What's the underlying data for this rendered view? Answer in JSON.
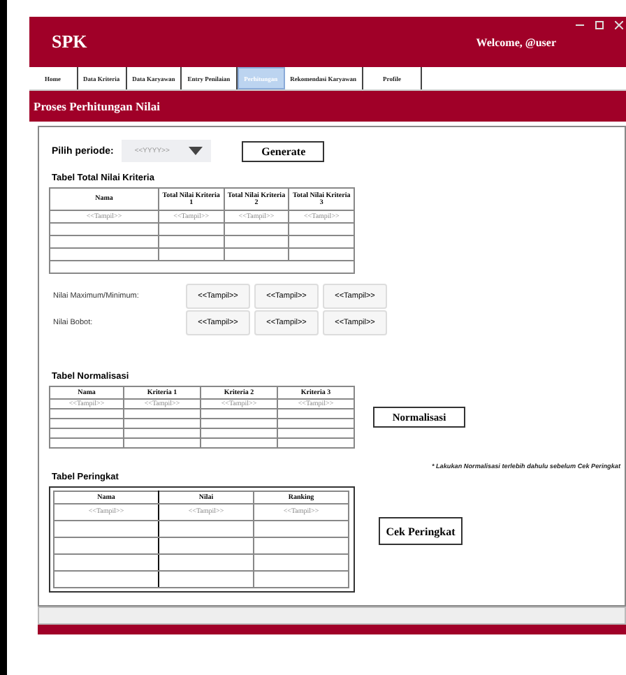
{
  "window": {
    "title": "SPK",
    "welcome": "Welcome, @user"
  },
  "tabs": [
    {
      "label": "Home",
      "selected": false
    },
    {
      "label": "Data Kriteria",
      "selected": false
    },
    {
      "label": "Data Karyawan",
      "selected": false
    },
    {
      "label": "Entry Penilaian",
      "selected": false
    },
    {
      "label": "Perhitungan",
      "selected": true
    },
    {
      "label": "Rekomendasi Karyawan",
      "selected": false
    },
    {
      "label": "Profile",
      "selected": false
    }
  ],
  "section_title": "Proses Perhitungan Nilai",
  "period": {
    "label": "Pilih periode:",
    "placeholder": "<<YYYY>>"
  },
  "generate_button": "Generate",
  "total_table": {
    "title": "Tabel Total Nilai Kriteria",
    "columns": [
      "Nama",
      "Total Nilai Kriteria 1",
      "Total Nilai Kriteria 2",
      "Total Nilai Kriteria 3"
    ],
    "rows": [
      [
        "<<Tampil>>",
        "<<Tampil>>",
        "<<Tampil>>",
        "<<Tampil>>"
      ]
    ]
  },
  "value_rows": [
    {
      "label": "Nilai Maximum/Minimum:",
      "values": [
        "<<Tampil>>",
        "<<Tampil>>",
        "<<Tampil>>"
      ]
    },
    {
      "label": "Nilai Bobot:",
      "values": [
        "<<Tampil>>",
        "<<Tampil>>",
        "<<Tampil>>"
      ]
    }
  ],
  "normal_table": {
    "title": "Tabel Normalisasi",
    "columns": [
      "Nama",
      "Kriteria 1",
      "Kriteria 2",
      "Kriteria 3"
    ],
    "rows": [
      [
        "<<Tampil>>",
        "<<Tampil>>",
        "<<Tampil>>",
        "<<Tampil>>"
      ]
    ]
  },
  "normal_button": "Normalisasi",
  "note": "* Lakukan Normalisasi terlebih dahulu sebelum Cek Peringkat",
  "rank_table": {
    "title": "Tabel Peringkat",
    "columns": [
      "Nama",
      "Nilai",
      "Ranking"
    ],
    "rows": [
      [
        "<<Tampil>>",
        "<<Tampil>>",
        "<<Tampil>>"
      ]
    ]
  },
  "rank_button": "Cek Peringkat"
}
